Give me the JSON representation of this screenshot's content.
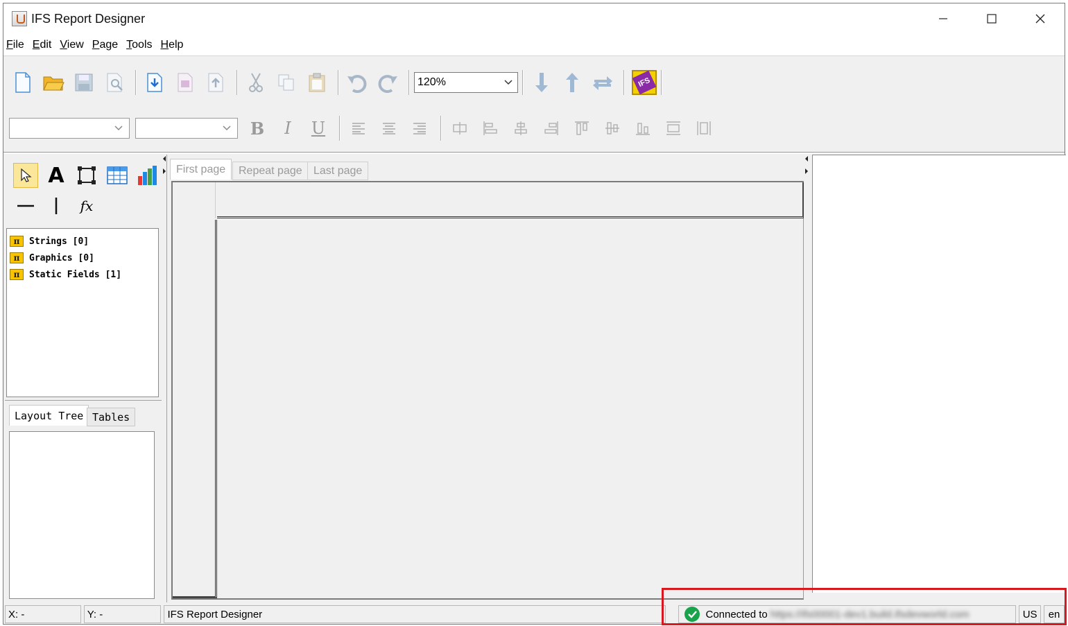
{
  "window": {
    "title": "IFS Report Designer",
    "controls": [
      "minimize",
      "maximize",
      "close"
    ]
  },
  "menu": [
    {
      "label": "File",
      "mnemonic": "F",
      "rest": "ile"
    },
    {
      "label": "Edit",
      "mnemonic": "E",
      "rest": "dit"
    },
    {
      "label": "View",
      "mnemonic": "V",
      "rest": "iew"
    },
    {
      "label": "Page",
      "mnemonic": "P",
      "rest": "age"
    },
    {
      "label": "Tools",
      "mnemonic": "T",
      "rest": "ools"
    },
    {
      "label": "Help",
      "mnemonic": "H",
      "rest": "elp"
    }
  ],
  "toolbar": {
    "zoom_value": "120%",
    "font_family_value": "",
    "font_size_value": "",
    "bold_label": "B",
    "italic_label": "I",
    "underline_label": "U"
  },
  "palette": {
    "text_tool_glyph": "A",
    "formula_tool_glyph": "fx"
  },
  "components": [
    {
      "label": "Strings [0]",
      "icon": "π"
    },
    {
      "label": "Graphics [0]",
      "icon": "π"
    },
    {
      "label": "Static Fields [1]",
      "icon": "π"
    }
  ],
  "left_tabs": [
    {
      "label": "Layout Tree",
      "active": true
    },
    {
      "label": "Tables",
      "active": false
    }
  ],
  "page_tabs": [
    {
      "label": "First page",
      "active": true
    },
    {
      "label": "Repeat page",
      "active": false
    },
    {
      "label": "Last page",
      "active": false
    }
  ],
  "status": {
    "x": "X: -",
    "y": "Y: -",
    "message": "IFS Report Designer",
    "connected_label": "Connected to",
    "connected_url": "https://ifs00001-dev1.build.ifsdevworld.com",
    "country": "US",
    "language": "en"
  },
  "colors": {
    "accent_highlight": "#d7191f",
    "connected_ok": "#19a34a",
    "ifs_brand_purple": "#8a2aa6",
    "ifs_brand_yellow": "#f3d000"
  }
}
